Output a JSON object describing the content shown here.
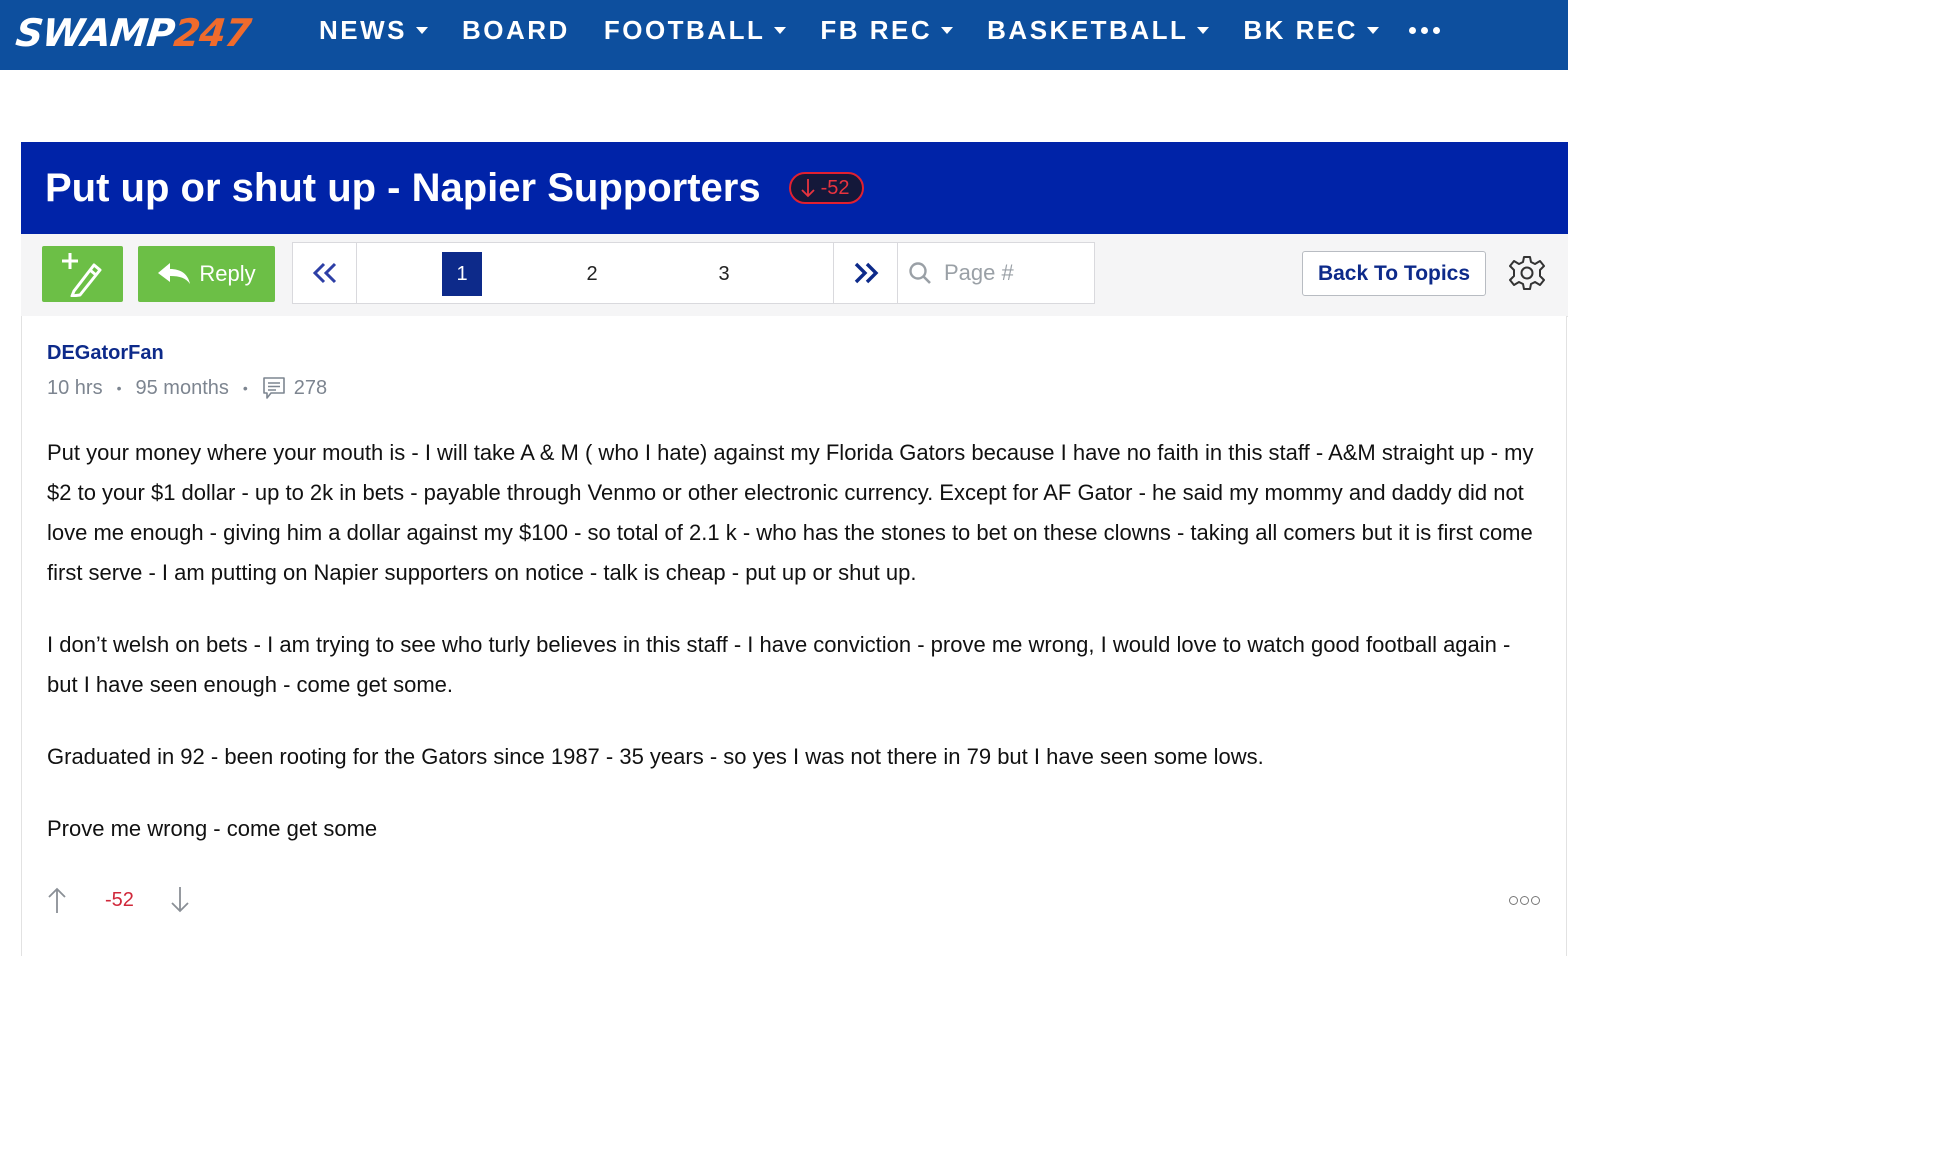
{
  "site": {
    "logo_main": "SWAMP",
    "logo_num": "247"
  },
  "nav": {
    "items": [
      {
        "label": "NEWS",
        "has_caret": true
      },
      {
        "label": "BOARD",
        "has_caret": false
      },
      {
        "label": "FOOTBALL",
        "has_caret": true
      },
      {
        "label": "FB REC",
        "has_caret": true
      },
      {
        "label": "BASKETBALL",
        "has_caret": true
      },
      {
        "label": "BK REC",
        "has_caret": true
      }
    ],
    "more_icon": "ellipsis-icon"
  },
  "thread": {
    "title": "Put up or shut up - Napier Supporters",
    "vote_badge": "-52"
  },
  "toolbar": {
    "reply_label": "Reply",
    "pages": [
      "1",
      "2",
      "3"
    ],
    "current_page": "1",
    "page_placeholder": "Page #",
    "back_label": "Back To Topics"
  },
  "post": {
    "author": "DEGatorFan",
    "time": "10 hrs",
    "member_for": "95 months",
    "post_count": "278",
    "paragraphs": [
      "Put your money where your mouth is - I will take A & M ( who I hate) against my Florida Gators because I have no faith in this staff - A&M straight up - my $2 to your $1 dollar - up to 2k in bets - payable through Venmo or other electronic currency. Except for AF Gator - he said my mommy and daddy did not love me enough - giving him a dollar against my $100 - so total of 2.1 k - who has the stones to bet on these clowns - taking all comers but it is first come first serve - I am putting on Napier supporters on notice - talk is cheap - put up or shut up.",
      "I don’t welsh on bets - I am trying to see who turly believes in this staff - I have conviction - prove me wrong, I would love to watch good football again - but I have seen enough - come get some.",
      "Graduated in 92 - been rooting for the Gators since 1987 - 35 years - so yes I was not there in 79 but I have seen some lows.",
      "Prove me wrong - come get some"
    ],
    "vote_count": "-52"
  },
  "colors": {
    "nav_bg": "#0d4f9e",
    "title_bg": "#0023a8",
    "accent_green": "#6cbf46",
    "link_blue": "#0d2a8a",
    "negative_red": "#d0283a",
    "logo_orange": "#f06b2c"
  }
}
